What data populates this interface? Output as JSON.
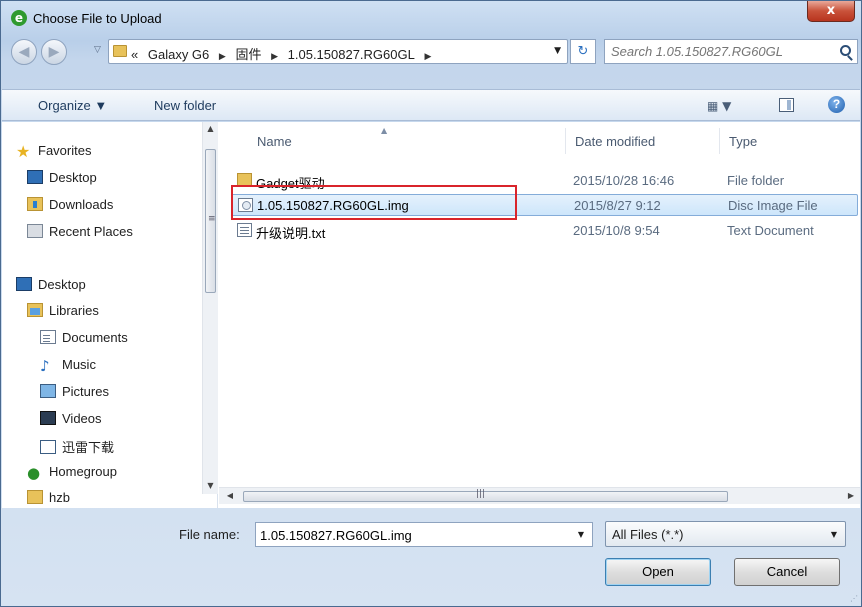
{
  "window": {
    "title": "Choose File to Upload",
    "close_label": "x"
  },
  "address": {
    "prefix": "«",
    "crumbs": [
      "Galaxy G6",
      "固件",
      "1.05.150827.RG60GL"
    ],
    "separator": "▶",
    "dropdown": "▼",
    "refresh": "↻"
  },
  "search": {
    "placeholder": "Search 1.05.150827.RG60GL"
  },
  "toolbar": {
    "organize_label": "Organize ▼",
    "new_folder_label": "New folder",
    "view_label": "▦ ▼",
    "help_label": "?"
  },
  "nav": {
    "favorites": "Favorites",
    "desktop1": "Desktop",
    "downloads": "Downloads",
    "recent_places": "Recent Places",
    "desktop2": "Desktop",
    "libraries": "Libraries",
    "documents": "Documents",
    "music": "Music",
    "pictures": "Pictures",
    "videos": "Videos",
    "xunlei": "迅雷下载",
    "homegroup": "Homegroup",
    "user": "hzb"
  },
  "columns": {
    "name": "Name",
    "date": "Date modified",
    "type": "Type"
  },
  "files": [
    {
      "name": "Gadget驱动",
      "date": "2015/10/28 16:46",
      "type": "File folder",
      "icon": "folder-icon"
    },
    {
      "name": "1.05.150827.RG60GL.img",
      "date": "2015/8/27 9:12",
      "type": "Disc Image File",
      "icon": "disc-image-icon"
    },
    {
      "name": "升级说明.txt",
      "date": "2015/10/8 9:54",
      "type": "Text Document",
      "icon": "text-file-icon"
    }
  ],
  "footer": {
    "filename_label": "File name:",
    "filename_value": "1.05.150827.RG60GL.img",
    "filter_value": "All Files (*.*)",
    "open_label": "Open",
    "cancel_label": "Cancel"
  },
  "colors": {
    "selection_border": "#84acd9",
    "highlight_annotation": "#d9242b"
  }
}
